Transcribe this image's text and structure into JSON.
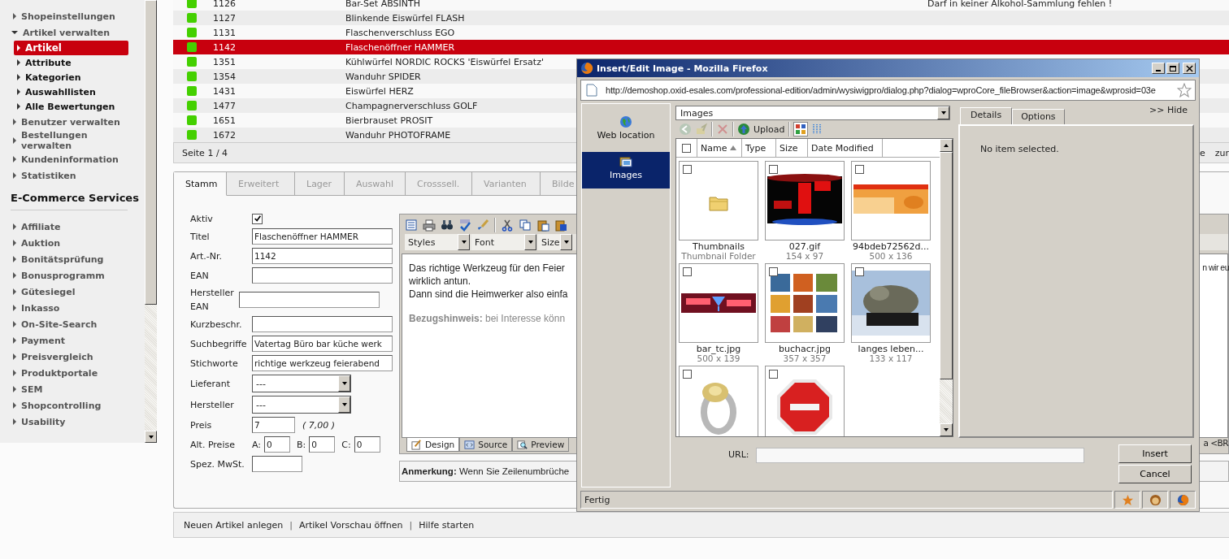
{
  "sidebar": {
    "items": [
      {
        "label": "Shopeinstellungen",
        "expanded": false
      },
      {
        "label": "Artikel verwalten",
        "expanded": true,
        "children": [
          {
            "label": "Artikel",
            "selected": true
          },
          {
            "label": "Attribute",
            "selected": false
          },
          {
            "label": "Kategorien",
            "selected": false
          },
          {
            "label": "Auswahllisten",
            "selected": false
          },
          {
            "label": "Alle Bewertungen",
            "selected": false
          }
        ]
      },
      {
        "label": "Benutzer verwalten",
        "expanded": false
      },
      {
        "label": "Bestellungen verwalten",
        "expanded": false
      },
      {
        "label": "Kundeninformation",
        "expanded": false
      },
      {
        "label": "Statistiken",
        "expanded": false
      }
    ],
    "services_heading": "E-Commerce Services",
    "services": [
      {
        "label": "Affiliate",
        "expanded": false
      },
      {
        "label": "Auktion",
        "expanded": false
      },
      {
        "label": "Bonitätsprüfung",
        "expanded": false
      },
      {
        "label": "Bonusprogramm",
        "expanded": false
      },
      {
        "label": "Gütesiegel",
        "expanded": false
      },
      {
        "label": "Inkasso",
        "expanded": false
      },
      {
        "label": "On-Site-Search",
        "expanded": false
      },
      {
        "label": "Payment",
        "expanded": false
      },
      {
        "label": "Preisvergleich",
        "expanded": false
      },
      {
        "label": "Produktportale",
        "expanded": false
      },
      {
        "label": "SEM",
        "expanded": false
      },
      {
        "label": "Shopcontrolling",
        "expanded": false
      },
      {
        "label": "Usability",
        "expanded": false
      }
    ]
  },
  "table": {
    "rows": [
      {
        "active": true,
        "number": "1126",
        "title": "Bar-Set ABSINTH",
        "description": "Darf in keiner Alkohol-Sammlung fehlen !",
        "selected": false
      },
      {
        "active": true,
        "number": "1127",
        "title": "Blinkende Eiswürfel FLASH",
        "selected": false
      },
      {
        "active": true,
        "number": "1131",
        "title": "Flaschenverschluss EGO",
        "selected": false
      },
      {
        "active": true,
        "number": "1142",
        "title": "Flaschenöffner HAMMER",
        "selected": true
      },
      {
        "active": true,
        "number": "1351",
        "title": "Kühlwürfel NORDIC ROCKS 'Eiswürfel Ersatz'",
        "selected": false
      },
      {
        "active": true,
        "number": "1354",
        "title": "Wanduhr SPIDER",
        "selected": false
      },
      {
        "active": true,
        "number": "1431",
        "title": "Eiswürfel HERZ",
        "selected": false
      },
      {
        "active": true,
        "number": "1477",
        "title": "Champagnerverschluss GOLF",
        "selected": false
      },
      {
        "active": true,
        "number": "1651",
        "title": "Bierbrauset PROSIT",
        "selected": false
      },
      {
        "active": true,
        "number": "1672",
        "title": "Wanduhr PHOTOFRAME",
        "selected": false
      }
    ],
    "pager": "Seite 1 / 4",
    "pager_right": [
      "e",
      "zur"
    ]
  },
  "tabs": [
    {
      "label": "Stamm",
      "selected": true
    },
    {
      "label": "Erweitert",
      "selected": false
    },
    {
      "label": "Lager",
      "selected": false
    },
    {
      "label": "Auswahl",
      "selected": false
    },
    {
      "label": "Crosssell.",
      "selected": false
    },
    {
      "label": "Varianten",
      "selected": false
    },
    {
      "label": "Bilde",
      "selected": false
    }
  ],
  "form": {
    "fields": [
      {
        "label": "Aktiv",
        "kind": "checkbox",
        "checked": true
      },
      {
        "label": "Titel",
        "kind": "text",
        "value": "Flaschenöffner HAMMER"
      },
      {
        "label": "Art.-Nr.",
        "kind": "text",
        "value": "1142"
      },
      {
        "label": "EAN",
        "kind": "text"
      },
      {
        "label": "Hersteller EAN",
        "kind": "text",
        "tall": true
      },
      {
        "label": "Kurzbeschr.",
        "kind": "text"
      },
      {
        "label": "Suchbegriffe",
        "kind": "text",
        "value": "Vatertag Büro bar küche werk"
      },
      {
        "label": "Stichworte",
        "kind": "text",
        "value": "richtige werkzeug feierabend"
      },
      {
        "label": "Lieferant",
        "kind": "select",
        "value": "---"
      },
      {
        "label": "Hersteller",
        "kind": "select",
        "value": "---"
      },
      {
        "label": "Preis",
        "kind": "price",
        "value": "7",
        "note": "( 7,00 )"
      },
      {
        "label": "Alt. Preise",
        "kind": "altprices",
        "prices": [
          {
            "label": "A:",
            "value": "0"
          },
          {
            "label": "B:",
            "value": "0"
          },
          {
            "label": "C:",
            "value": "0"
          }
        ]
      },
      {
        "label": "Spez. MwSt.",
        "kind": "short"
      }
    ]
  },
  "editor": {
    "styles": "Styles",
    "font": "Font",
    "size": "Size",
    "lines": [
      {
        "text": "Das richtige Werkzeug für den Feier",
        "tail": "n wir eu"
      },
      {
        "text": "wirklich antun."
      },
      {
        "text": "Dann sind die Heimwerker also einfa"
      },
      {
        "text": "**Bezugshinweis:** bei Interesse könn",
        "muted": true
      }
    ],
    "modes": [
      {
        "label": "Design",
        "selected": true
      },
      {
        "label": "Source",
        "selected": false
      },
      {
        "label": "Preview",
        "selected": false
      }
    ],
    "modes_tail": "a <BR",
    "note": "**Anmerkung:** Wenn Sie Zeilenumbrüche"
  },
  "footer": [
    {
      "kind": "link",
      "label": "Neuen Artikel anlegen"
    },
    {
      "kind": "separator",
      "label": "|"
    },
    {
      "kind": "link",
      "label": "Artikel Vorschau öffnen"
    },
    {
      "kind": "separator",
      "label": "|"
    },
    {
      "kind": "link",
      "label": "Hilfe starten"
    }
  ],
  "dialog": {
    "title": "Insert/Edit Image - Mozilla Firefox",
    "url": "http://demoshop.oxid-esales.com/professional-edition/admin/wysiwigpro/dialog.php?dialog=wproCore_fileBrowser&action=image&wprosid=03e",
    "sources": [
      {
        "label": "Web location",
        "selected": false
      },
      {
        "label": "Images",
        "selected": true
      }
    ],
    "folder": "Images",
    "upload": "Upload",
    "all_checked": false,
    "columns": [
      {
        "label": "Name",
        "sorted": true
      },
      {
        "label": "Type",
        "sorted": false
      },
      {
        "label": "Size",
        "sorted": false
      },
      {
        "label": "Date Modified",
        "sorted": false
      }
    ],
    "items": [
      {
        "kind": "folder",
        "name": "Thumbnails",
        "info": "Thumbnail Folder",
        "checked": false
      },
      {
        "kind": "picture",
        "name": "027.gif",
        "info": "154 x 97",
        "checked": false
      },
      {
        "kind": "picture",
        "name": "94bdeb72562d...",
        "info": "500 x 136",
        "checked": false
      },
      {
        "kind": "picture",
        "name": "bar_tc.jpg",
        "info": "500 x 139",
        "checked": false
      },
      {
        "kind": "picture",
        "name": "buchacr.jpg",
        "info": "357 x 357",
        "checked": false
      },
      {
        "kind": "picture",
        "name": "langes leben...",
        "info": "133 x 117",
        "checked": false
      },
      {
        "kind": "picture",
        "checked": false
      },
      {
        "kind": "picture",
        "checked": false
      }
    ],
    "panel_tabs": [
      {
        "label": "Details",
        "selected": true
      },
      {
        "label": "Options",
        "selected": false
      }
    ],
    "hide": ">> Hide",
    "details": "No item selected.",
    "url_label": "URL:",
    "buttons": [
      "Insert",
      "Cancel"
    ],
    "status": "Fertig"
  }
}
